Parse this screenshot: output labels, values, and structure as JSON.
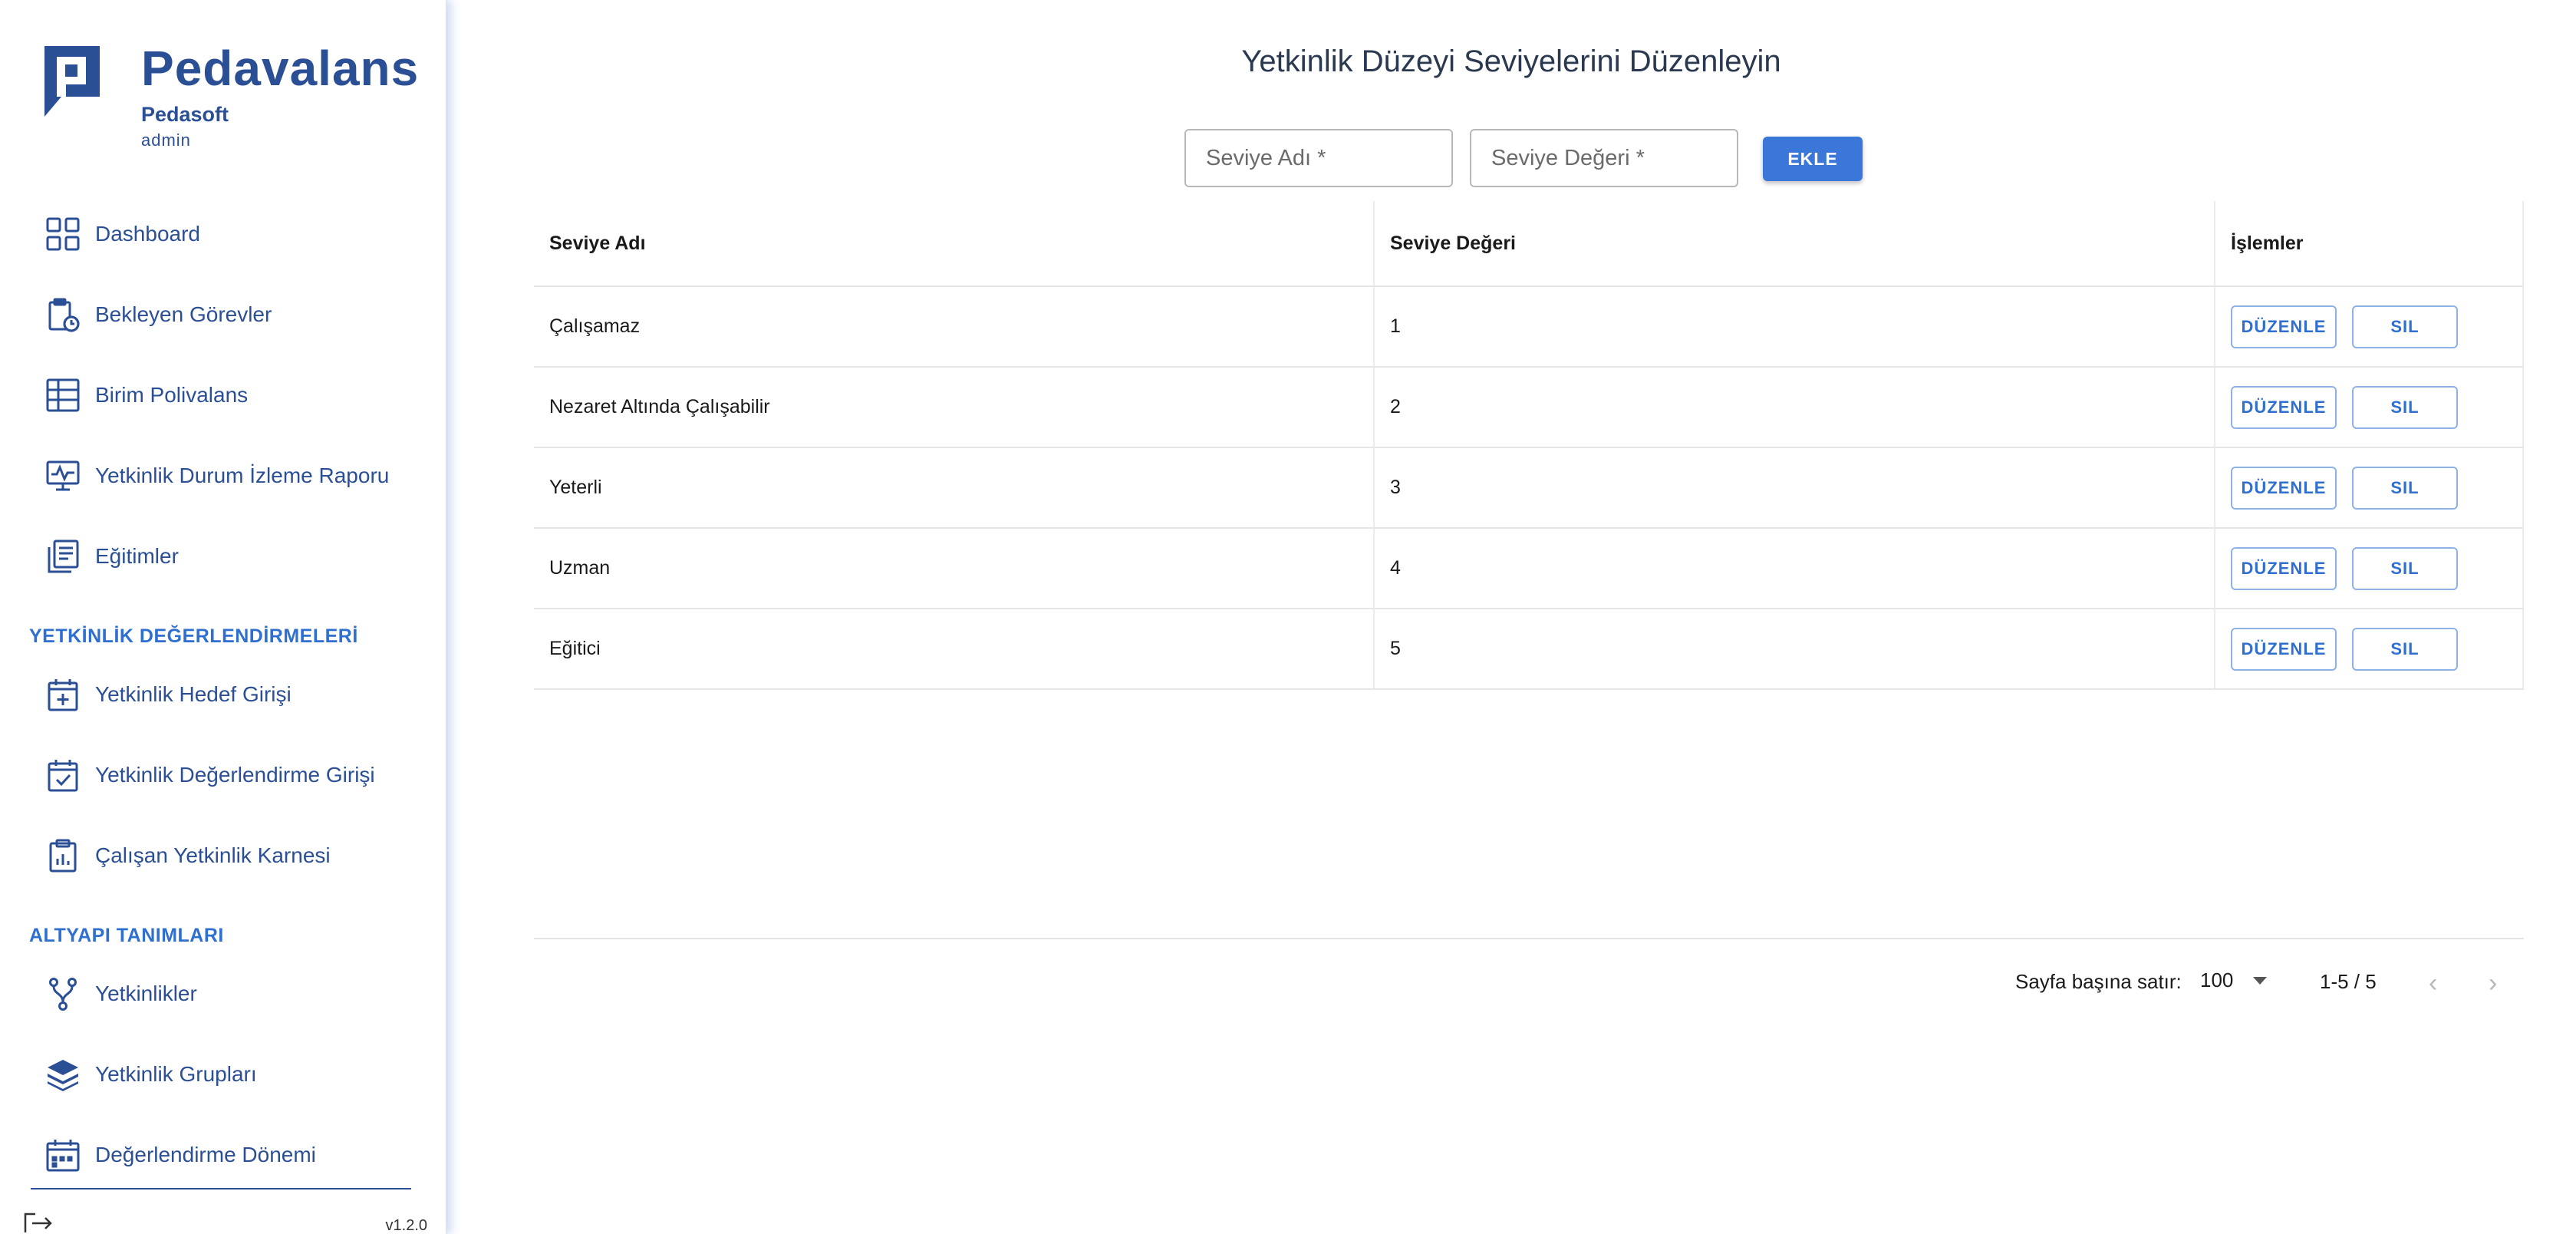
{
  "brand": {
    "title": "Pedavalans",
    "org": "Pedasoft",
    "user": "admin"
  },
  "sidebar": {
    "main_items": [
      {
        "label": "Dashboard",
        "icon": "dashboard-grid-icon"
      },
      {
        "label": "Bekleyen Görevler",
        "icon": "clipboard-clock-icon"
      },
      {
        "label": "Birim Polivalans",
        "icon": "table-icon"
      },
      {
        "label": "Yetkinlik Durum İzleme Raporu",
        "icon": "monitor-chart-icon"
      },
      {
        "label": "Eğitimler",
        "icon": "document-list-icon"
      }
    ],
    "section1_title": "YETKİNLİK DEĞERLENDİRMELERİ",
    "section1_items": [
      {
        "label": "Yetkinlik Hedef Girişi",
        "icon": "calendar-plus-icon"
      },
      {
        "label": "Yetkinlik Değerlendirme Girişi",
        "icon": "calendar-check-icon"
      },
      {
        "label": "Çalışan Yetkinlik Karnesi",
        "icon": "clipboard-chart-icon"
      }
    ],
    "section2_title": "ALTYAPI TANIMLARI",
    "section2_items": [
      {
        "label": "Yetkinlikler",
        "icon": "branch-icon"
      },
      {
        "label": "Yetkinlik Grupları",
        "icon": "layers-icon"
      },
      {
        "label": "Değerlendirme Dönemi",
        "icon": "calendar-dots-icon"
      }
    ],
    "version": "v1.2.0"
  },
  "main": {
    "title": "Yetkinlik Düzeyi Seviyelerini Düzenleyin",
    "form": {
      "name_placeholder": "Seviye Adı *",
      "value_placeholder": "Seviye Değeri *",
      "add_label": "EKLE"
    },
    "table": {
      "headers": [
        "Seviye Adı",
        "Seviye Değeri",
        "İşlemler"
      ],
      "rows": [
        {
          "name": "Çalışamaz",
          "value": "1"
        },
        {
          "name": "Nezaret Altında Çalışabilir",
          "value": "2"
        },
        {
          "name": "Yeterli",
          "value": "3"
        },
        {
          "name": "Uzman",
          "value": "4"
        },
        {
          "name": "Eğitici",
          "value": "5"
        }
      ],
      "edit_label": "DÜZENLE",
      "delete_label": "SIL"
    },
    "pagination": {
      "rows_per_page_label": "Sayfa başına satır:",
      "rows_per_page": "100",
      "range": "1-5 / 5",
      "prev_icon": "chevron-left-icon",
      "next_icon": "chevron-right-icon"
    }
  }
}
